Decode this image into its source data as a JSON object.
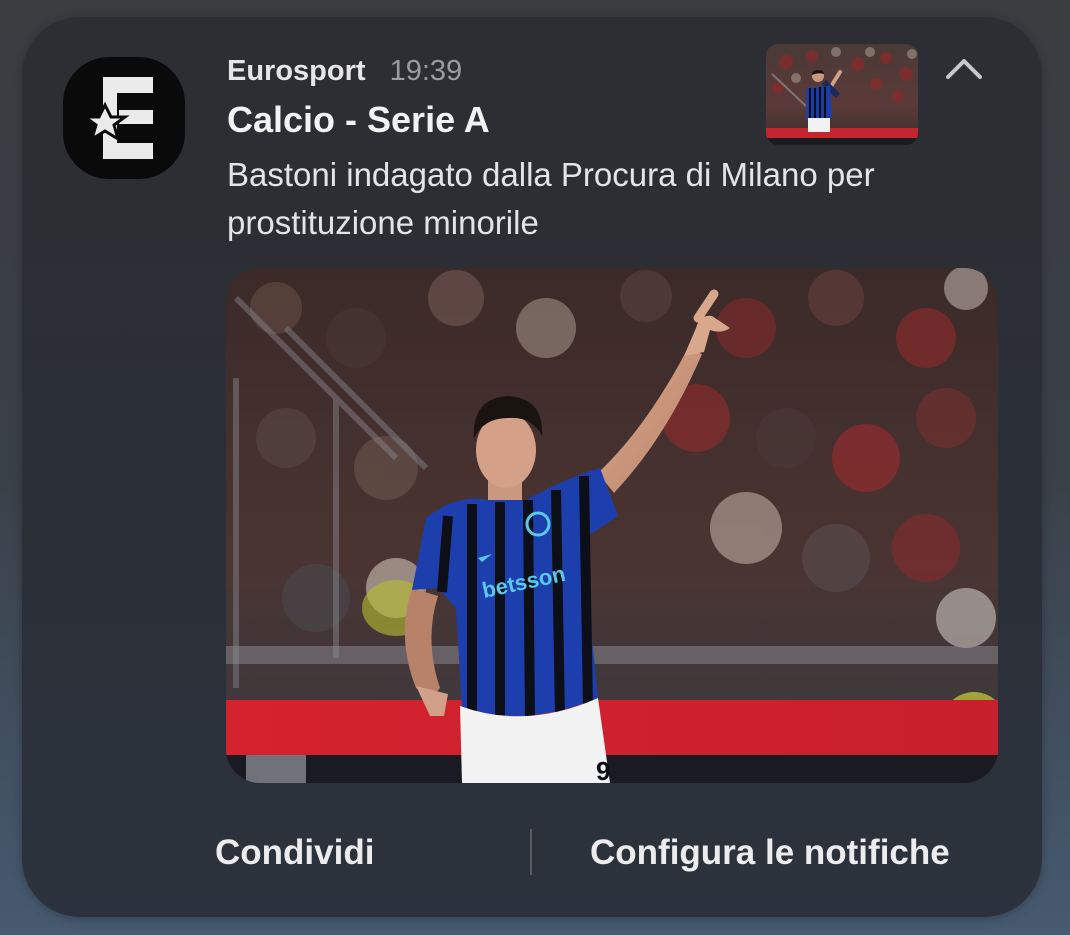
{
  "notification": {
    "app_name": "Eurosport",
    "time": "19:39",
    "title": "Calcio - Serie A",
    "body": "Bastoni indagato dalla Procura di Milano per prostituzione minorile",
    "icons": {
      "app": "eurosport-logo-icon",
      "collapse": "chevron-up-icon"
    },
    "thumbnail": "player-thumbnail",
    "image": "player-photo"
  },
  "actions": {
    "share_label": "Condividi",
    "configure_label": "Configura le notifiche"
  },
  "colors": {
    "card_bg": "#2c2f35",
    "text_primary": "#f2f2f4",
    "text_secondary": "#9a9ca0",
    "jersey_blue": "#1d3fae",
    "jersey_black": "#0d0f18"
  }
}
